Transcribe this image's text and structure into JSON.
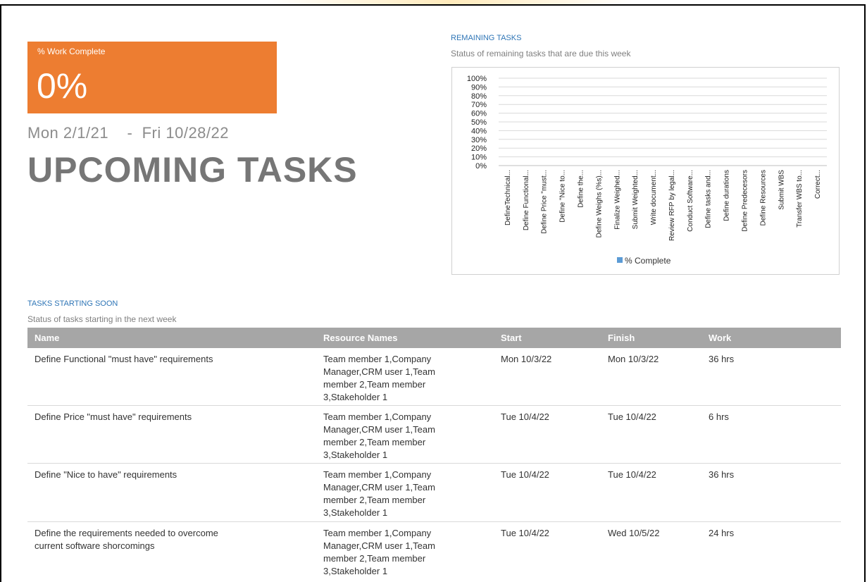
{
  "kpi": {
    "label": "% Work Complete",
    "value": "0%",
    "color": "#ed7d31"
  },
  "date_range": {
    "start": "Mon 2/1/21",
    "separator": "-",
    "end": "Fri 10/28/22"
  },
  "title": "UPCOMING TASKS",
  "remaining": {
    "heading": "REMAINING TASKS",
    "subtitle": "Status of remaining tasks that are due this week"
  },
  "chart_data": {
    "type": "bar",
    "categories": [
      "DefineTechnical...",
      "Define Functional...",
      "Define Price \"must...",
      "Define \"Nice to...",
      "Define the...",
      "Define Weighs (%s)...",
      "Finalize Weighed...",
      "Submit Weighted...",
      "Write document...",
      "Review RFP by legal...",
      "Conduct Software...",
      "Define tasks and...",
      "Define durations",
      "Define Predecesors",
      "Define Resources",
      "Submit WBS",
      "Transfer WBS to...",
      "Correct..."
    ],
    "series": [
      {
        "name": "% Complete",
        "values": [
          0,
          0,
          0,
          0,
          0,
          0,
          0,
          0,
          0,
          0,
          0,
          0,
          0,
          0,
          0,
          0,
          0,
          0
        ],
        "color": "#5b9bd5"
      }
    ],
    "yticks": [
      "100%",
      "90%",
      "80%",
      "70%",
      "60%",
      "50%",
      "40%",
      "30%",
      "20%",
      "10%",
      "0%"
    ],
    "ylim": [
      0,
      100
    ],
    "grid": true,
    "legend": "bottom"
  },
  "tasks": {
    "heading": "TASKS STARTING SOON",
    "subtitle": "Status of tasks starting in the next week",
    "columns": [
      "Name",
      "Resource Names",
      "Start",
      "Finish",
      "Work"
    ],
    "rows": [
      {
        "name": "Define Functional \"must have\" requirements",
        "resources": [
          "Team member 1,Company",
          "Manager,CRM user 1,Team",
          "member 2,Team member",
          "3,Stakeholder 1"
        ],
        "start": "Mon 10/3/22",
        "finish": "Mon 10/3/22",
        "work": "36 hrs"
      },
      {
        "name": "Define Price \"must have\" requirements",
        "resources": [
          "Team member 1,Company",
          "Manager,CRM user 1,Team",
          "member 2,Team member",
          "3,Stakeholder 1"
        ],
        "start": "Tue 10/4/22",
        "finish": "Tue 10/4/22",
        "work": "6 hrs"
      },
      {
        "name": "Define \"Nice to have\" requirements",
        "resources": [
          "Team member 1,Company",
          "Manager,CRM user 1,Team",
          "member 2,Team member",
          "3,Stakeholder 1"
        ],
        "start": "Tue 10/4/22",
        "finish": "Tue 10/4/22",
        "work": "36 hrs"
      },
      {
        "name_lines": [
          "Define the requirements needed to overcome",
          "current software shorcomings"
        ],
        "resources": [
          "Team member 1,Company",
          "Manager,CRM user 1,Team",
          "member 2,Team member",
          "3,Stakeholder 1"
        ],
        "start": "Tue 10/4/22",
        "finish": "Wed 10/5/22",
        "work": "24 hrs"
      }
    ]
  }
}
